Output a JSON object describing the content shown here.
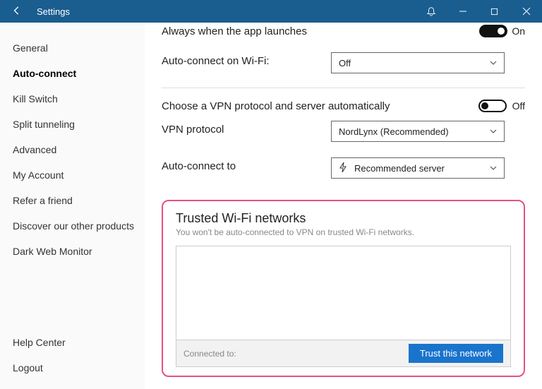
{
  "titlebar": {
    "title": "Settings"
  },
  "sidebar": {
    "items": [
      {
        "label": "General"
      },
      {
        "label": "Auto-connect"
      },
      {
        "label": "Kill Switch"
      },
      {
        "label": "Split tunneling"
      },
      {
        "label": "Advanced"
      },
      {
        "label": "My Account"
      },
      {
        "label": "Refer a friend"
      },
      {
        "label": "Discover our other products"
      },
      {
        "label": "Dark Web Monitor"
      }
    ],
    "footer": {
      "help": "Help Center",
      "logout": "Logout"
    }
  },
  "content": {
    "launch_row": {
      "label": "Always when the app launches",
      "state": "On"
    },
    "wifi_row": {
      "label": "Auto-connect on Wi-Fi:",
      "selected": "Off"
    },
    "auto_protocol": {
      "label": "Choose a VPN protocol and server automatically",
      "state": "Off"
    },
    "protocol": {
      "label": "VPN protocol",
      "selected": "NordLynx (Recommended)"
    },
    "connect_to": {
      "label": "Auto-connect to",
      "selected": "Recommended server"
    },
    "trusted": {
      "heading": "Trusted Wi-Fi networks",
      "desc": "You won't be auto-connected to VPN on trusted Wi-Fi networks.",
      "connected_label": "Connected to:",
      "button": "Trust this network"
    }
  }
}
